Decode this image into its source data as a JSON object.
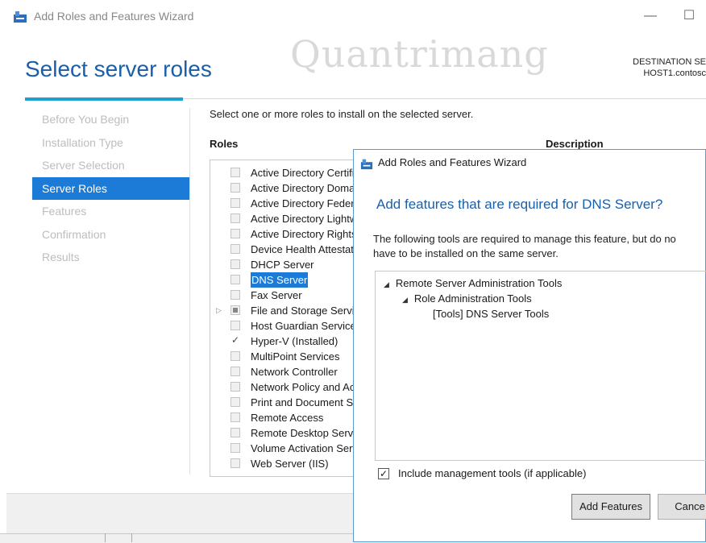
{
  "window": {
    "title": "Add Roles and Features Wizard",
    "minimize_glyph": "—",
    "maximize_glyph": "☐"
  },
  "header": {
    "page_title": "Select server roles",
    "destination_label": "DESTINATION SE",
    "destination_host": "HOST1.contosc",
    "watermark": "Quantrimang"
  },
  "nav": {
    "items": [
      {
        "label": "Before You Begin",
        "active": false
      },
      {
        "label": "Installation Type",
        "active": false
      },
      {
        "label": "Server Selection",
        "active": false
      },
      {
        "label": "Server Roles",
        "active": true
      },
      {
        "label": "Features",
        "active": false
      },
      {
        "label": "Confirmation",
        "active": false
      },
      {
        "label": "Results",
        "active": false
      }
    ]
  },
  "main": {
    "instruction": "Select one or more roles to install on the selected server.",
    "roles_header": "Roles",
    "description_header": "Description",
    "roles": [
      {
        "label": "Active Directory Certificate Services",
        "state": "unchecked"
      },
      {
        "label": "Active Directory Domain Services",
        "state": "unchecked"
      },
      {
        "label": "Active Directory Federation Services",
        "state": "unchecked"
      },
      {
        "label": "Active Directory Lightweight Directory Services",
        "state": "unchecked"
      },
      {
        "label": "Active Directory Rights Management Services",
        "state": "unchecked"
      },
      {
        "label": "Device Health Attestation",
        "state": "unchecked"
      },
      {
        "label": "DHCP Server",
        "state": "unchecked"
      },
      {
        "label": "DNS Server",
        "state": "unchecked",
        "selected": true
      },
      {
        "label": "Fax Server",
        "state": "unchecked"
      },
      {
        "label": "File and Storage Services",
        "state": "partial",
        "expander": "▷"
      },
      {
        "label": "Host Guardian Service",
        "state": "unchecked"
      },
      {
        "label": "Hyper-V (Installed)",
        "state": "checked"
      },
      {
        "label": "MultiPoint Services",
        "state": "unchecked"
      },
      {
        "label": "Network Controller",
        "state": "unchecked"
      },
      {
        "label": "Network Policy and Access Services",
        "state": "unchecked"
      },
      {
        "label": "Print and Document Services",
        "state": "unchecked"
      },
      {
        "label": "Remote Access",
        "state": "unchecked"
      },
      {
        "label": "Remote Desktop Services",
        "state": "unchecked"
      },
      {
        "label": "Volume Activation Services",
        "state": "unchecked"
      },
      {
        "label": "Web Server (IIS)",
        "state": "unchecked"
      }
    ]
  },
  "dialog": {
    "title": "Add Roles and Features Wizard",
    "heading": "Add features that are required for DNS Server?",
    "text_line1": "The following tools are required to manage this feature, but do no",
    "text_line2": "have to be installed on the same server.",
    "tree": [
      {
        "label": "Remote Server Administration Tools",
        "level": 0,
        "expanded": true
      },
      {
        "label": "Role Administration Tools",
        "level": 1,
        "expanded": true
      },
      {
        "label": "[Tools] DNS Server Tools",
        "level": 2,
        "expanded": false
      }
    ],
    "include_label": "Include management tools (if applicable)",
    "include_checked": true,
    "add_button": "Add Features",
    "cancel_button": "Cance"
  }
}
